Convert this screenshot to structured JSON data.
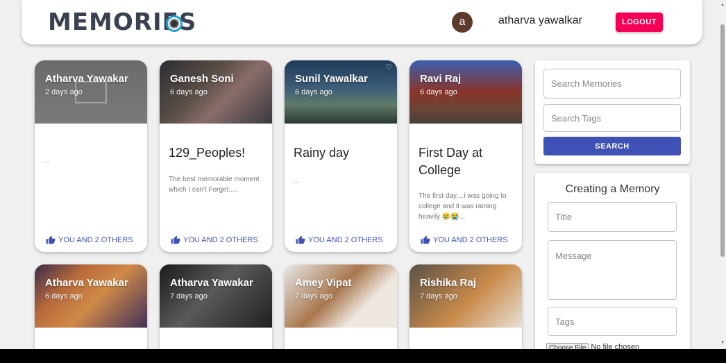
{
  "header": {
    "brand": "MEMORIES",
    "avatar_letter": "a",
    "username": "atharva yawalkar",
    "logout_label": "LOGOUT"
  },
  "posts": [
    {
      "author": "Atharva Yawakar",
      "time": "2 days ago",
      "title": "",
      "message": "...",
      "likes": "YOU AND 2 OTHERS"
    },
    {
      "author": "Ganesh Soni",
      "time": "6 days ago",
      "title": "129_Peoples!",
      "message": "The best memorable moment which I can't Forget.....",
      "likes": "YOU AND 2 OTHERS"
    },
    {
      "author": "Sunil Yawalkar",
      "time": "6 days ago",
      "title": "Rainy day",
      "message": "...",
      "likes": "YOU AND 2 OTHERS"
    },
    {
      "author": "Ravi Raj",
      "time": "6 days ago",
      "title": "First Day at College",
      "message": "The first day....i was going to college and it was raining heavily 😢😭...",
      "likes": "YOU AND 2 OTHERS"
    },
    {
      "author": "Atharva Yawakar",
      "time": "6 days ago"
    },
    {
      "author": "Atharva Yawakar",
      "time": "7 days ago"
    },
    {
      "author": "Amey Vipat",
      "time": "7 days ago"
    },
    {
      "author": "Rishika Raj",
      "time": "7 days ago"
    }
  ],
  "search": {
    "memories_placeholder": "Search Memories",
    "tags_placeholder": "Search Tags",
    "button_label": "SEARCH"
  },
  "form": {
    "heading": "Creating a Memory",
    "title_placeholder": "Title",
    "message_placeholder": "Message",
    "tags_placeholder": "Tags",
    "file_button": "Choose File",
    "file_status": "No file chosen"
  },
  "colors": {
    "logout": "#f50057",
    "primary": "#3f51b5",
    "avatar": "#5d3a2c"
  }
}
